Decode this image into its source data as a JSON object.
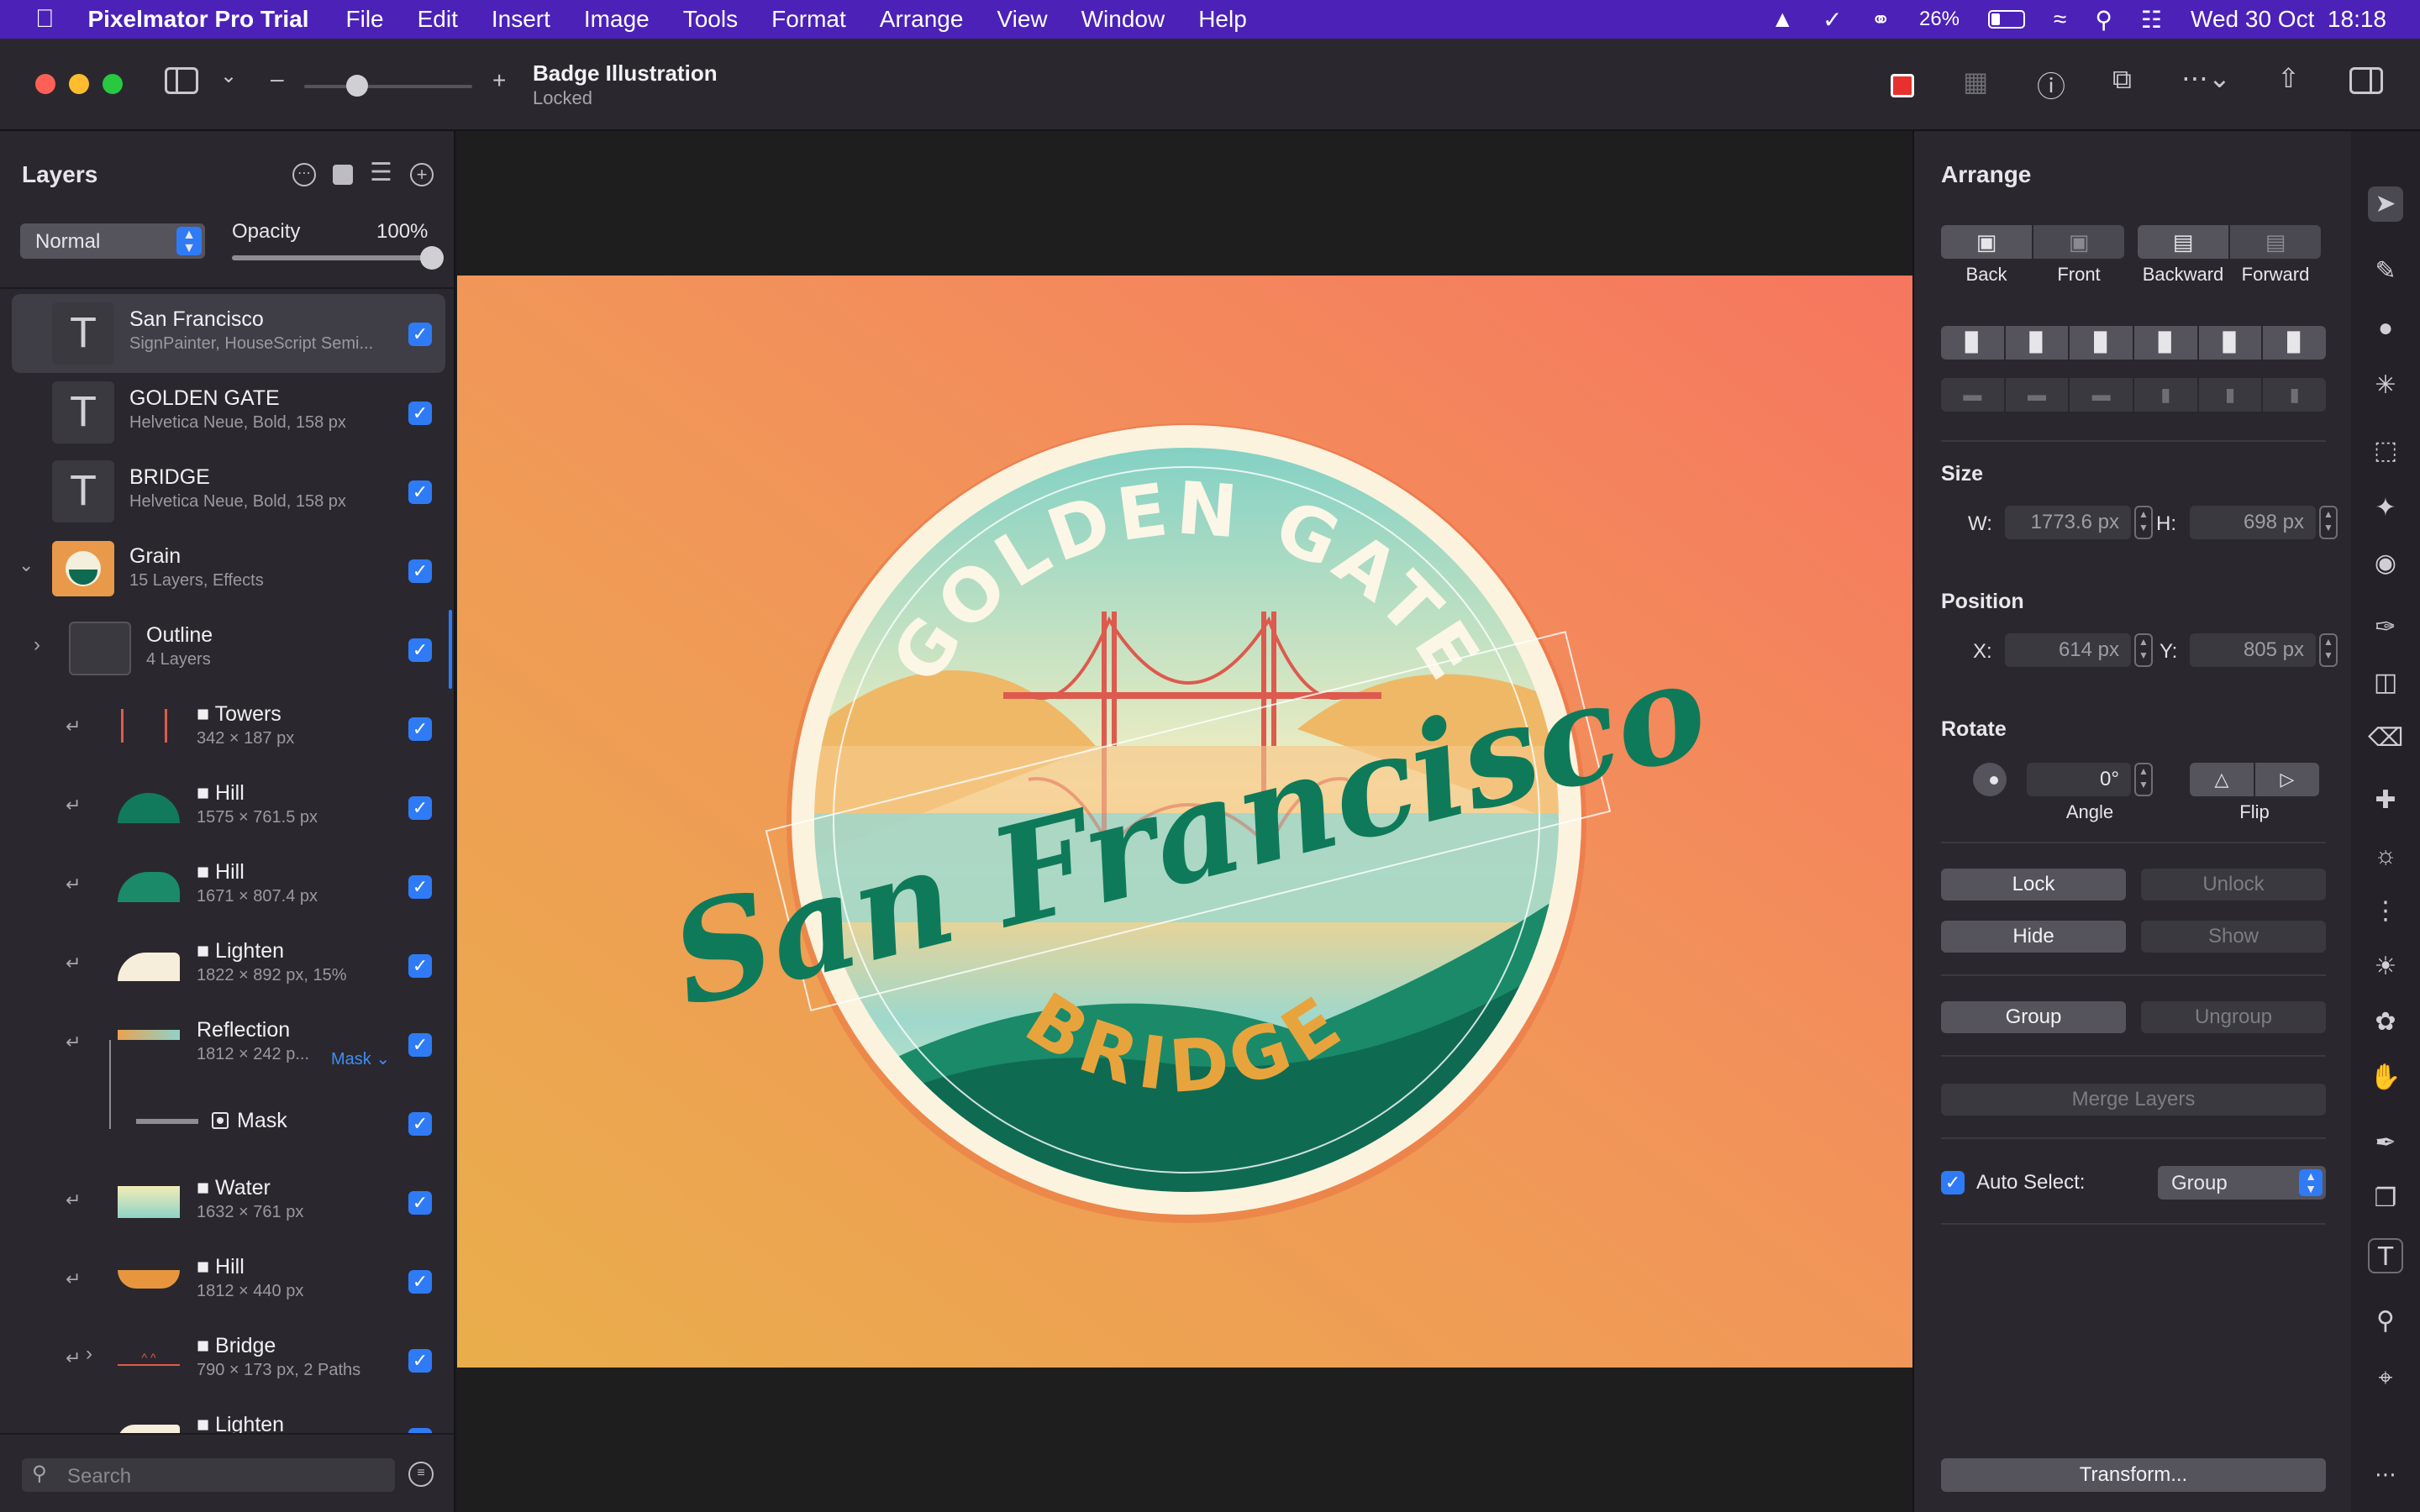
{
  "menubar": {
    "app_name": "Pixelmator Pro Trial",
    "items": [
      "File",
      "Edit",
      "Insert",
      "Image",
      "Tools",
      "Format",
      "Arrange",
      "View",
      "Window",
      "Help"
    ],
    "battery": "26%",
    "clock": "Wed 30 Oct  18:18"
  },
  "titlebar": {
    "doc_title": "Badge Illustration",
    "doc_status": "Locked"
  },
  "layers": {
    "title": "Layers",
    "blend_mode": "Normal",
    "opacity_label": "Opacity",
    "opacity_value": "100%",
    "opacity_fraction": 1.0,
    "search_placeholder": "Search",
    "mask_label": "Mask",
    "items": [
      {
        "name": "San Francisco",
        "sub": "SignPainter, HouseScript Semi..."
      },
      {
        "name": "GOLDEN GATE",
        "sub": "Helvetica Neue, Bold, 158 px"
      },
      {
        "name": "BRIDGE",
        "sub": "Helvetica Neue, Bold, 158 px"
      },
      {
        "name": "Grain",
        "sub": "15 Layers, Effects"
      },
      {
        "name": "Outline",
        "sub": "4 Layers"
      },
      {
        "name": "Towers",
        "sub": "342 × 187 px"
      },
      {
        "name": "Hill",
        "sub": "1575 × 761.5 px"
      },
      {
        "name": "Hill",
        "sub": "1671 × 807.4 px"
      },
      {
        "name": "Lighten",
        "sub": "1822 × 892 px, 15%"
      },
      {
        "name": "Reflection",
        "sub": "1812 × 242 p..."
      },
      {
        "name": "Mask",
        "sub": ""
      },
      {
        "name": "Water",
        "sub": "1632 × 761 px"
      },
      {
        "name": "Hill",
        "sub": "1812 × 440 px"
      },
      {
        "name": "Bridge",
        "sub": "790 × 173 px, 2 Paths"
      },
      {
        "name": "Lighten",
        "sub": ""
      }
    ]
  },
  "canvas": {
    "badge_top": "GOLDEN GATE",
    "badge_script": "San Francisco",
    "badge_bottom": "BRIDGE",
    "colors": {
      "bg_left": "#eaa94e",
      "bg_right": "#f67a5e",
      "teal": "#0f6a52",
      "cream": "#fbf3de",
      "sky": "#8fd3c8"
    }
  },
  "arrange": {
    "title": "Arrange",
    "order_buttons": [
      "Back",
      "Front",
      "Backward",
      "Forward"
    ],
    "size_label": "Size",
    "w_label": "W:",
    "w_value": "1773.6 px",
    "h_label": "H:",
    "h_value": "698 px",
    "position_label": "Position",
    "x_label": "X:",
    "x_value": "614 px",
    "y_label": "Y:",
    "y_value": "805 px",
    "rotate_label": "Rotate",
    "angle_value": "0°",
    "angle_label": "Angle",
    "flip_label": "Flip",
    "lock": "Lock",
    "unlock": "Unlock",
    "hide": "Hide",
    "show": "Show",
    "group": "Group",
    "ungroup": "Ungroup",
    "merge": "Merge Layers",
    "auto_select_label": "Auto Select:",
    "auto_select_value": "Group",
    "transform": "Transform..."
  }
}
